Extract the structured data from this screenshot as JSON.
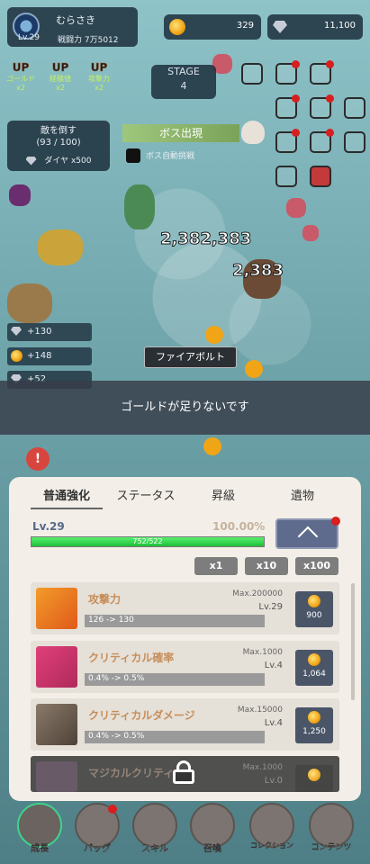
{
  "player": {
    "name": "むらさき",
    "level": "Lv.29",
    "power": "戦闘力 7万5012"
  },
  "resources": {
    "gold": "329",
    "diamond": "11,100"
  },
  "buffs": [
    {
      "up": "UP",
      "label": "ゴールド",
      "count": "x2"
    },
    {
      "up": "UP",
      "label": "経験値",
      "count": "x2"
    },
    {
      "up": "UP",
      "label": "攻撃力",
      "count": "x2"
    }
  ],
  "stage": {
    "label": "STAGE",
    "number": "4"
  },
  "quest": {
    "title": "敵を倒す",
    "progress": "(93 / 100)",
    "reward": "ダイヤ x500"
  },
  "boss": {
    "label": "ボス出現",
    "auto_label": "ボス自動挑戦"
  },
  "damage": [
    "2,382,383",
    "2,383"
  ],
  "drops": [
    "+130",
    "+148",
    "+52"
  ],
  "skill_tooltip": "ファイアボルト",
  "toast": "ゴールドが足りないです",
  "panel": {
    "tabs": [
      "普通強化",
      "ステータス",
      "昇級",
      "遺物"
    ],
    "level": "Lv.29",
    "percent": "100.00%",
    "xp_text": "752/522",
    "xp_fraction": 1.0,
    "multipliers": [
      "x1",
      "x10",
      "x100"
    ],
    "cards": [
      {
        "name": "攻撃力",
        "max": "Max.200000",
        "lv": "Lv.29",
        "range": "126 -> 130",
        "cost": "900"
      },
      {
        "name": "クリティカル確率",
        "max": "Max.1000",
        "lv": "Lv.4",
        "range": "0.4% -> 0.5%",
        "cost": "1,064"
      },
      {
        "name": "クリティカルダメージ",
        "max": "Max.15000",
        "lv": "Lv.4",
        "range": "0.4% -> 0.5%",
        "cost": "1,250"
      },
      {
        "name": "マジカルクリティカ",
        "max": "Max.1000",
        "lv": "Lv.0",
        "range": "",
        "cost": ""
      }
    ]
  },
  "nav": [
    "成長",
    "バッグ",
    "スキル",
    "召喚",
    "コレクション",
    "コンテンツ"
  ]
}
